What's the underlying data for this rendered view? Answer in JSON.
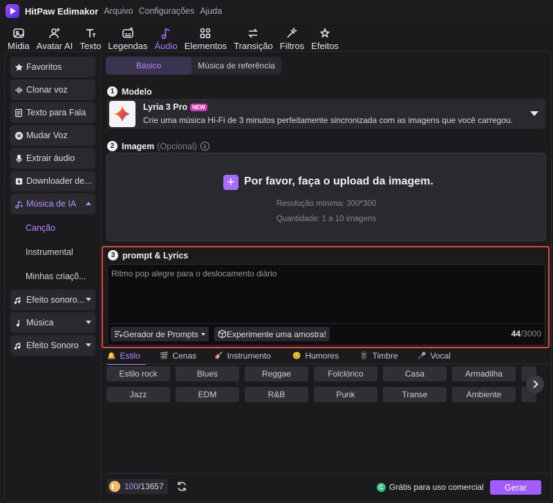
{
  "app": {
    "name": "HitPaw Edimakor",
    "menu": [
      "Arquivo",
      "Configurações",
      "Ajuda"
    ]
  },
  "toolbar": [
    {
      "label": "Mídia",
      "icon": "media-icon"
    },
    {
      "label": "Avatar AI",
      "icon": "avatar-icon"
    },
    {
      "label": "Texto",
      "icon": "text-icon"
    },
    {
      "label": "Legendas",
      "icon": "subtitles-icon"
    },
    {
      "label": "Áudio",
      "icon": "audio-icon",
      "active": true
    },
    {
      "label": "Elementos",
      "icon": "elements-icon"
    },
    {
      "label": "Transição",
      "icon": "transition-icon"
    },
    {
      "label": "Filtros",
      "icon": "filters-icon"
    },
    {
      "label": "Efeitos",
      "icon": "effects-icon"
    }
  ],
  "sidebar": {
    "items": [
      {
        "label": "Favoritos",
        "icon": "star-icon"
      },
      {
        "label": "Clonar voz",
        "icon": "voice-clone-icon"
      },
      {
        "label": "Texto para Fala",
        "icon": "text-to-speech-icon"
      },
      {
        "label": "Mudar Voz",
        "icon": "voice-change-icon"
      },
      {
        "label": "Extrair áudio",
        "icon": "microphone-icon"
      },
      {
        "label": "Downloader de...",
        "icon": "download-icon"
      },
      {
        "label": "Música de IA",
        "icon": "ai-music-icon",
        "expanded": true
      },
      {
        "label": "Efeito sonoro...",
        "icon": "sound-effect-icon"
      },
      {
        "label": "Música",
        "icon": "music-note-icon"
      },
      {
        "label": "Efeito Sonoro",
        "icon": "sound-effect-icon"
      }
    ],
    "sub_items": [
      {
        "label": "Canção",
        "active": true
      },
      {
        "label": "Instrumental"
      },
      {
        "label": "Minhas criaçõ..."
      }
    ]
  },
  "main": {
    "tabs": [
      {
        "label": "Básico",
        "active": true
      },
      {
        "label": "Música de referência"
      }
    ],
    "model": {
      "section_number": "1",
      "section_title": "Modelo",
      "name": "Lyria 3 Pro",
      "badge": "NEW",
      "description": "Crie uma música Hi-Fi de 3 minutos perfeitamente sincronizada com as imagens que você carregou."
    },
    "image": {
      "section_number": "2",
      "section_title": "Imagem",
      "optional": "(Opcional)",
      "info": "i",
      "upload_plus": "+",
      "upload_title": "Por favor, faça o upload da imagem.",
      "resolution": "Resolução mínima: 300*300",
      "quantity": "Quantidade: 1 a 10 imagens"
    },
    "prompt": {
      "section_number": "3",
      "section_title": "prompt & Lyrics",
      "text": "Ritmo pop alegre para o deslocamento diário",
      "generator_button": "Gerador de Prompts",
      "sample_button": "Experimente uma amostra!",
      "count": "44",
      "max": "/3000"
    },
    "categories": [
      {
        "label": "Estilo",
        "icon": "bell-icon",
        "active": true
      },
      {
        "label": "Cenas",
        "icon": "clapper-icon"
      },
      {
        "label": "Instrumento",
        "icon": "guitar-icon"
      },
      {
        "label": "Humores",
        "icon": "smile-icon"
      },
      {
        "label": "Timbre",
        "icon": "timbre-icon"
      },
      {
        "label": "Vocal",
        "icon": "vocal-icon"
      }
    ],
    "chips_row1": [
      "Estilo rock",
      "Blues",
      "Reggae",
      "Folclórico",
      "Casa",
      "Armadilha"
    ],
    "chips_row2": [
      "Jazz",
      "EDM",
      "R&B",
      "Punk",
      "Transe",
      "Ambiente"
    ]
  },
  "footer": {
    "credits_used": "100",
    "credits_total": "/13657",
    "free_mark": "C",
    "free_label": "Grátis para uso comercial",
    "generate_button": "Gerar"
  },
  "colors": {
    "accent": "#a77bff",
    "highlight_border": "#e0473e",
    "generate": "#9f5cff",
    "free_badge": "#2ec27e"
  }
}
